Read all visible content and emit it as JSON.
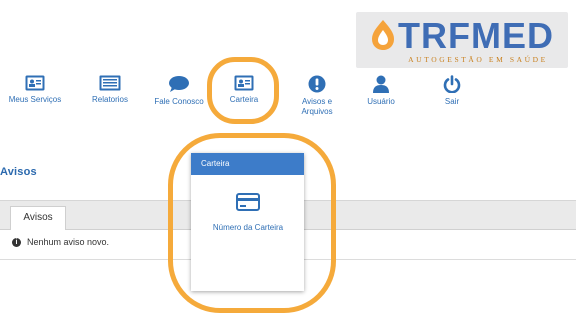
{
  "logo": {
    "name": "TRFMED",
    "tagline": "AUTOGESTÃO EM SAÚDE",
    "text_color": "#3f6db5",
    "accent_color": "#f5a33b"
  },
  "nav": {
    "items": [
      {
        "label": "Meus Serviços",
        "icon": "id-card-icon"
      },
      {
        "label": "Relatorios",
        "icon": "document-list-icon"
      },
      {
        "label": "Fale Conosco",
        "icon": "chat-bubble-icon"
      },
      {
        "label": "Carteira",
        "icon": "id-card-icon"
      },
      {
        "label": "Avisos e Arquivos",
        "icon": "alert-circle-icon"
      },
      {
        "label": "Usuário",
        "icon": "user-icon"
      },
      {
        "label": "Sair",
        "icon": "power-icon"
      }
    ],
    "icon_color": "#2f6fb5"
  },
  "section": {
    "title": "Avisos",
    "tab_label": "Avisos",
    "notice": "Nenhum aviso novo.",
    "notice_icon": "info-circle-icon"
  },
  "dropdown": {
    "title": "Carteira",
    "item_label": "Número da Carteira",
    "item_icon": "credit-card-icon",
    "header_color": "#3d7cc9"
  },
  "highlight_color": "#f5aa3b"
}
